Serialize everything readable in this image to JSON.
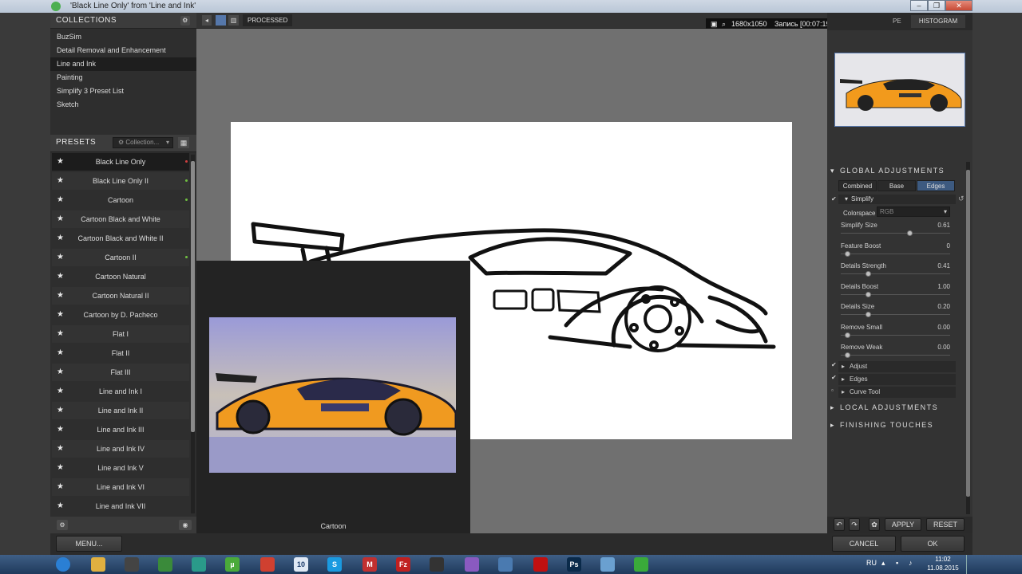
{
  "window": {
    "title": "'Black Line Only' from 'Line and Ink'"
  },
  "collections": {
    "header": "COLLECTIONS",
    "items": [
      {
        "label": "BuzSim",
        "selected": false
      },
      {
        "label": "Detail Removal and Enhancement",
        "selected": false
      },
      {
        "label": "Line and Ink",
        "selected": true
      },
      {
        "label": "Painting",
        "selected": false
      },
      {
        "label": "Simplify 3 Preset List",
        "selected": false
      },
      {
        "label": "Sketch",
        "selected": false
      }
    ]
  },
  "presets": {
    "header": "PRESETS",
    "collection_select": "Collection...",
    "items": [
      {
        "label": "Black Line Only",
        "selected": true,
        "dot": "#d04040"
      },
      {
        "label": "Black Line Only II",
        "selected": false,
        "dot": "#70c040"
      },
      {
        "label": "Cartoon",
        "selected": false,
        "dot": "#70c040"
      },
      {
        "label": "Cartoon Black and White",
        "selected": false,
        "dot": ""
      },
      {
        "label": "Cartoon Black and White II",
        "selected": false,
        "dot": ""
      },
      {
        "label": "Cartoon II",
        "selected": false,
        "dot": "#70c040"
      },
      {
        "label": "Cartoon Natural",
        "selected": false,
        "dot": ""
      },
      {
        "label": "Cartoon Natural II",
        "selected": false,
        "dot": ""
      },
      {
        "label": "Cartoon by D. Pacheco",
        "selected": false,
        "dot": ""
      },
      {
        "label": "Flat I",
        "selected": false,
        "dot": ""
      },
      {
        "label": "Flat II",
        "selected": false,
        "dot": ""
      },
      {
        "label": "Flat III",
        "selected": false,
        "dot": ""
      },
      {
        "label": "Line and Ink I",
        "selected": false,
        "dot": ""
      },
      {
        "label": "Line and Ink II",
        "selected": false,
        "dot": ""
      },
      {
        "label": "Line and Ink III",
        "selected": false,
        "dot": ""
      },
      {
        "label": "Line and Ink IV",
        "selected": false,
        "dot": ""
      },
      {
        "label": "Line and Ink V",
        "selected": false,
        "dot": ""
      },
      {
        "label": "Line and Ink VI",
        "selected": false,
        "dot": ""
      },
      {
        "label": "Line and Ink VII",
        "selected": false,
        "dot": ""
      }
    ]
  },
  "topbar": {
    "view_mode": "PROCESSED"
  },
  "recorder": {
    "resolution": "1680x1050",
    "recording": "Запись [00:07:19]"
  },
  "preview_popup": {
    "caption": "Cartoon"
  },
  "right_panel": {
    "tab_histogram": "HISTOGRAM",
    "tab_partial": "PE",
    "global_adjustments": "GLOBAL ADJUSTMENTS",
    "tabs": [
      {
        "label": "Combined",
        "active": false
      },
      {
        "label": "Base",
        "active": false
      },
      {
        "label": "Edges",
        "active": true
      }
    ],
    "simplify_label": "Simplify",
    "colorspace_label": "Colorspace",
    "colorspace_value": "RGB",
    "sliders": [
      {
        "label": "Simplify Size",
        "value": "0.61",
        "fraction": 0.61
      },
      {
        "label": "Feature Boost",
        "value": "0",
        "fraction": 0.0
      },
      {
        "label": "Details Strength",
        "value": "0.41",
        "fraction": 0.2
      },
      {
        "label": "Details Boost",
        "value": "1.00",
        "fraction": 0.2
      },
      {
        "label": "Details Size",
        "value": "0.20",
        "fraction": 0.2
      },
      {
        "label": "Remove Small",
        "value": "0.00",
        "fraction": 0.0
      },
      {
        "label": "Remove Weak",
        "value": "0.00",
        "fraction": 0.0
      }
    ],
    "subsections": [
      {
        "label": "Adjust",
        "checked": true
      },
      {
        "label": "Edges",
        "checked": true
      },
      {
        "label": "Curve Tool",
        "checked": false
      }
    ],
    "local_adjustments": "LOCAL ADJUSTMENTS",
    "finishing_touches": "FINISHING TOUCHES",
    "apply": "APPLY",
    "reset": "RESET"
  },
  "bottom": {
    "menu": "MENU...",
    "cancel": "CANCEL",
    "ok": "OK"
  },
  "taskbar": {
    "lang": "RU",
    "time": "11:02",
    "date": "11.08.2015",
    "calendar_day": "10",
    "icons": [
      {
        "name": "start-orb-icon",
        "color": "#2a7fd4",
        "glyph": ""
      },
      {
        "name": "explorer-icon",
        "color": "#e0b040",
        "glyph": ""
      },
      {
        "name": "film-icon",
        "color": "#444",
        "glyph": ""
      },
      {
        "name": "spreadsheet-icon",
        "color": "#3a8a3a",
        "glyph": ""
      },
      {
        "name": "cube-icon",
        "color": "#2a9a8a",
        "glyph": ""
      },
      {
        "name": "utorrent-icon",
        "color": "#4aaa3a",
        "glyph": "µ"
      },
      {
        "name": "chrome-icon",
        "color": "#d04030",
        "glyph": ""
      },
      {
        "name": "calendar-icon",
        "color": "#dfe8f4",
        "glyph": ""
      },
      {
        "name": "skype-icon",
        "color": "#1a9ae0",
        "glyph": "S"
      },
      {
        "name": "mail-icon",
        "color": "#c03030",
        "glyph": "M"
      },
      {
        "name": "filezilla-icon",
        "color": "#c02020",
        "glyph": "Fz"
      },
      {
        "name": "media-player-icon",
        "color": "#333",
        "glyph": ""
      },
      {
        "name": "picasa-icon",
        "color": "#8a5ac0",
        "glyph": ""
      },
      {
        "name": "screen-icon",
        "color": "#4a7ab0",
        "glyph": ""
      },
      {
        "name": "record-icon",
        "color": "#c01010",
        "glyph": ""
      },
      {
        "name": "photoshop-icon",
        "color": "#0a2a4a",
        "glyph": "Ps"
      },
      {
        "name": "window-icon",
        "color": "#6aa0d0",
        "glyph": ""
      },
      {
        "name": "topaz-icon",
        "color": "#3aaa3a",
        "glyph": ""
      }
    ]
  }
}
